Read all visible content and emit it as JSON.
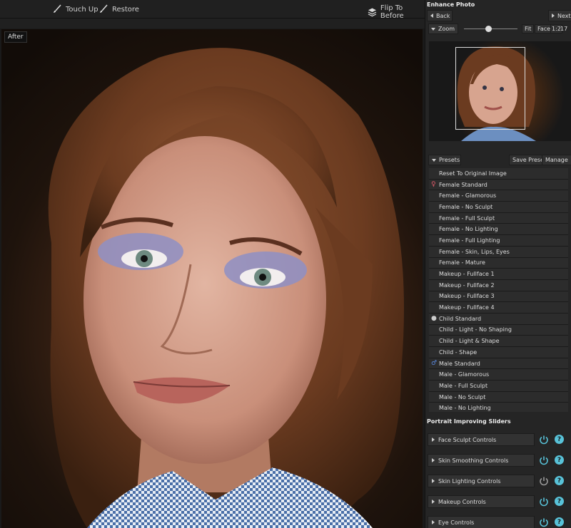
{
  "toolbar": {
    "touch_up": "Touch Up",
    "restore": "Restore",
    "flip": "Flip To Before"
  },
  "photo": {
    "label": "After"
  },
  "panel": {
    "title": "Enhance Photo",
    "back": "Back",
    "next": "Next",
    "zoom": "Zoom",
    "zoom_level": 0.45,
    "fit": "Fit",
    "face": "Face",
    "ratio": "1:2",
    "ratio_value": "17"
  },
  "presets": {
    "header": "Presets",
    "save": "Save Preset",
    "manage": "Manage",
    "items": [
      {
        "label": "Reset To Original Image",
        "icon": ""
      },
      {
        "label": "Female Standard",
        "icon": "female-icon"
      },
      {
        "label": "Female - Glamorous",
        "icon": ""
      },
      {
        "label": "Female - No Sculpt",
        "icon": ""
      },
      {
        "label": "Female - Full Sculpt",
        "icon": ""
      },
      {
        "label": "Female - No Lighting",
        "icon": ""
      },
      {
        "label": "Female - Full Lighting",
        "icon": ""
      },
      {
        "label": "Female - Skin, Lips, Eyes",
        "icon": ""
      },
      {
        "label": "Female - Mature",
        "icon": ""
      },
      {
        "label": "Makeup - Fullface 1",
        "icon": ""
      },
      {
        "label": "Makeup - Fullface 2",
        "icon": ""
      },
      {
        "label": "Makeup - Fullface 3",
        "icon": ""
      },
      {
        "label": "Makeup - Fullface 4",
        "icon": ""
      },
      {
        "label": "Child Standard",
        "icon": "child-icon"
      },
      {
        "label": "Child - Light - No Shaping",
        "icon": ""
      },
      {
        "label": "Child - Light & Shape",
        "icon": ""
      },
      {
        "label": "Child - Shape",
        "icon": ""
      },
      {
        "label": "Male Standard",
        "icon": "male-icon"
      },
      {
        "label": "Male - Glamorous",
        "icon": ""
      },
      {
        "label": "Male - Full Sculpt",
        "icon": ""
      },
      {
        "label": "Male - No Sculpt",
        "icon": ""
      },
      {
        "label": "Male - No Lighting",
        "icon": ""
      }
    ]
  },
  "sliders": {
    "title": "Portrait Improving Sliders",
    "help": "?",
    "items": [
      {
        "label": "Face Sculpt Controls",
        "on": true
      },
      {
        "label": "Skin Smoothing Controls",
        "on": true
      },
      {
        "label": "Skin Lighting Controls",
        "on": false
      },
      {
        "label": "Makeup Controls",
        "on": true
      },
      {
        "label": "Eye Controls",
        "on": true
      }
    ]
  },
  "colors": {
    "accent": "#58c2d8",
    "female": "#e05a6a",
    "male": "#5a8ae0",
    "power_on": "#58c2d8",
    "power_off": "#9a9a9a"
  }
}
